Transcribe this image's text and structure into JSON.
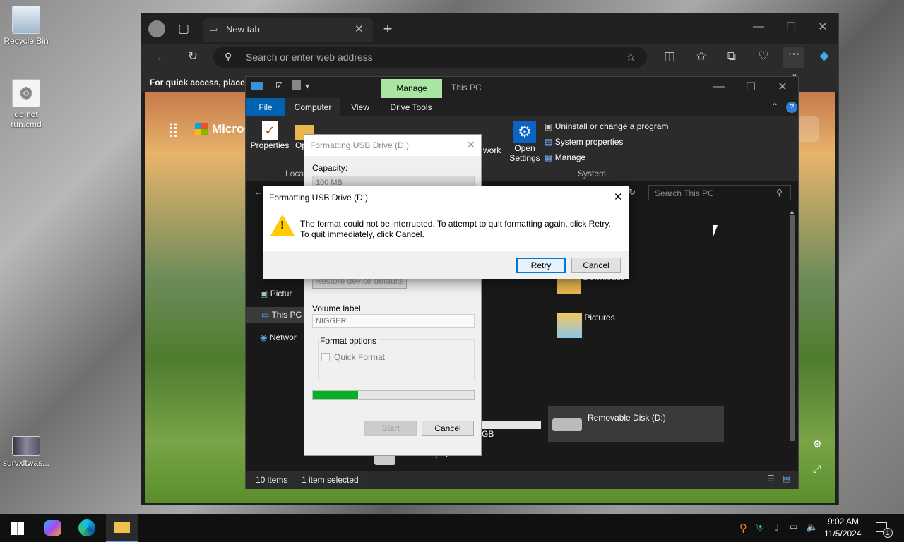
{
  "desktop": {
    "icons": [
      {
        "label": "Recycle Bin"
      },
      {
        "label": "do not run.cmd"
      },
      {
        "label": "survxltwas..."
      }
    ]
  },
  "browser": {
    "tab_title": "New tab",
    "address_placeholder": "Search or enter web address",
    "bookmarks_hint": "For quick access, place y",
    "page_logo_text": "Micros"
  },
  "explorer": {
    "qat_manage_tab": "Manage",
    "title": "This PC",
    "menu": [
      "File",
      "Computer",
      "View",
      "Drive Tools"
    ],
    "ribbon": {
      "properties": "Properties",
      "open_partial": "Op",
      "network_partial": "work",
      "location_group": "Locat",
      "open_settings_1": "Open",
      "open_settings_2": "Settings",
      "uninstall": "Uninstall or change a program",
      "system_properties": "System properties",
      "manage": "Manage",
      "system_group": "System"
    },
    "search_placeholder": "Search This PC",
    "nav": {
      "pictures": "Pictur",
      "this_pc": "This PC",
      "network": "Networ"
    },
    "folders": {
      "downloads": "Downloads",
      "pictures": "Pictures"
    },
    "drives": {
      "size_fragment": "GB",
      "removable": "Removable Disk (D:)",
      "cd_drive": "CD Drive (E:)"
    },
    "status": {
      "items": "10 items",
      "selected": "1 item selected"
    }
  },
  "format_dialog": {
    "title": "Formatting USB Drive (D:)",
    "capacity_label": "Capacity:",
    "capacity_value": "100 MB",
    "restore_button": "Restore device defaults",
    "volume_label": "Volume label",
    "volume_value": "NIGGER",
    "format_options": "Format options",
    "quick_format": "Quick Format",
    "progress": 0.28,
    "start_button": "Start",
    "cancel_button": "Cancel"
  },
  "error_dialog": {
    "title": "Formatting USB Drive (D:)",
    "message_line1": "The format could not be interrupted. To attempt to quit formatting again, click Retry.",
    "message_line2": "To quit immediately, click Cancel.",
    "retry": "Retry",
    "cancel": "Cancel"
  },
  "taskbar": {
    "time": "9:02 AM",
    "date": "11/5/2024",
    "notification_count": "1"
  },
  "colors": {
    "accent": "#0078d7",
    "progress": "#06b025",
    "manage_tab": "#a8e6a1",
    "warning": "#ffcc00"
  }
}
